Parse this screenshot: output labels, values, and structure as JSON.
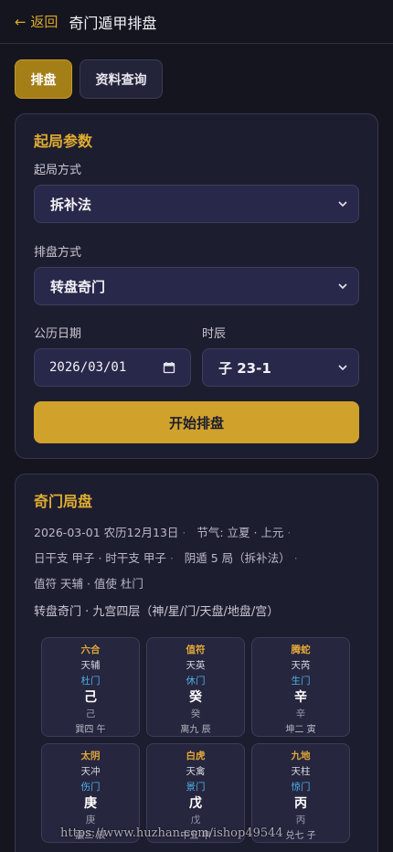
{
  "header": {
    "back_label": "← 返回",
    "title": "奇门遁甲排盘"
  },
  "tabs": [
    {
      "label": "排盘",
      "active": true
    },
    {
      "label": "资料查询",
      "active": false
    }
  ],
  "params": {
    "title": "起局参数",
    "method_label": "起局方式",
    "method_value": "拆补法",
    "pan_label": "排盘方式",
    "pan_value": "转盘奇门",
    "date_label": "公历日期",
    "date_value": "2026/03/01",
    "hour_label": "时辰",
    "hour_value": "子 23-1",
    "start_button": "开始排盘"
  },
  "result": {
    "title": "奇门局盘",
    "line1": "2026-03-01 农历12月13日",
    "jieqi": "节气: 立夏 · 上元",
    "ganzhi": "日干支 甲子 · 时干支 甲子",
    "ju": "阴遁 5 局（拆补法）",
    "zhifu": "值符 天辅 · 值使 杜门",
    "subtitle": "转盘奇门 · 九宫四层（神/星/门/天盘/地盘/宫）",
    "cells": [
      {
        "shen": "六合",
        "xing": "天辅",
        "men": "杜门",
        "tian": "己",
        "di": "己",
        "gong": "巽四 午"
      },
      {
        "shen": "值符",
        "xing": "天英",
        "men": "休门",
        "tian": "癸",
        "di": "癸",
        "gong": "离九 辰"
      },
      {
        "shen": "腾蛇",
        "xing": "天芮",
        "men": "生门",
        "tian": "辛",
        "di": "辛",
        "gong": "坤二 寅"
      },
      {
        "shen": "太阴",
        "xing": "天冲",
        "men": "伤门",
        "tian": "庚",
        "di": "庚",
        "gong": "震三 辰"
      },
      {
        "shen": "白虎",
        "xing": "天禽",
        "men": "景门",
        "tian": "戊",
        "di": "戊",
        "gong": "中五 申"
      },
      {
        "shen": "九地",
        "xing": "天柱",
        "men": "惊门",
        "tian": "丙",
        "di": "丙",
        "gong": "兑七 子"
      }
    ]
  },
  "watermark": "https://www.huzhan.com/ishop49544",
  "colors": {
    "accent": "#d0a22b",
    "gold_text": "#e0ad30",
    "door_blue": "#4fb0e6",
    "bg": "#15151f"
  }
}
